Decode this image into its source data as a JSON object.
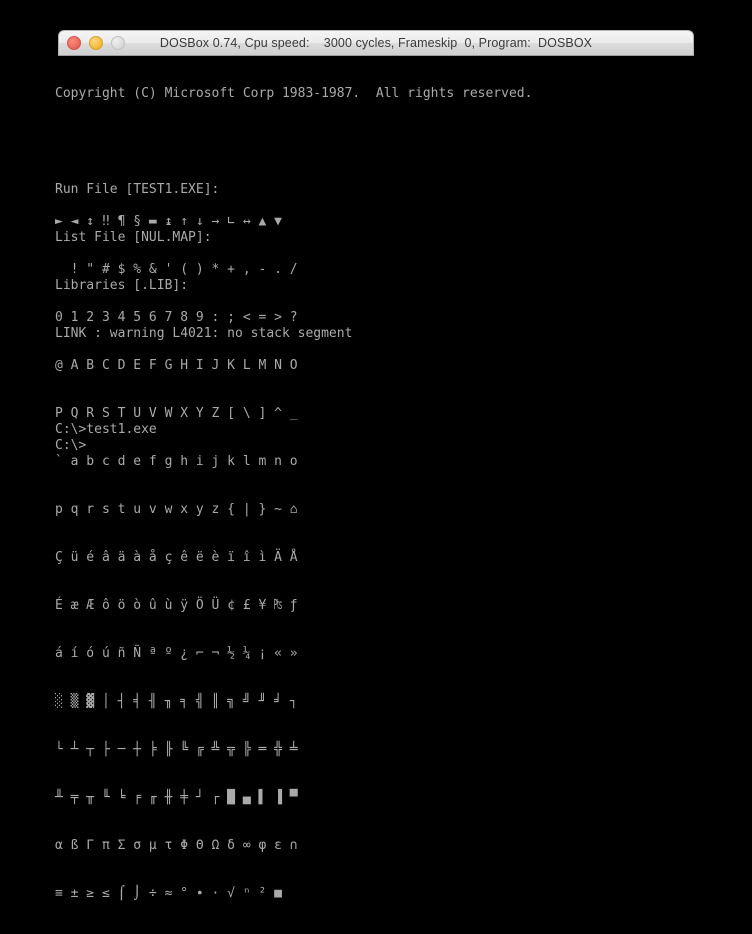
{
  "window": {
    "title": "DOSBox 0.74, Cpu speed:    3000 cycles, Frameskip  0, Program:  DOSBOX",
    "buttons": {
      "close": "close-button",
      "minimize": "minimize-button",
      "zoom": "zoom-button"
    },
    "colors": {
      "close": "#ee6a5f",
      "minimize": "#f6bd3b",
      "zoom": "#dcdcdc",
      "titlebar_bg": "#ececec",
      "title_text": "#3a3a3a"
    }
  },
  "console": {
    "colors": {
      "background": "#000000",
      "foreground": "#aaaaaa"
    },
    "lines": [
      "Copyright (C) Microsoft Corp 1983-1987.  All rights reserved.",
      "",
      "Run File [TEST1.EXE]:",
      "List File [NUL.MAP]:",
      "Libraries [.LIB]:",
      "LINK : warning L4021: no stack segment",
      "",
      "C:\\>test1.exe"
    ],
    "charmap_rows": [
      "► ◄ ↕ ‼ ¶ § ▬ ↨ ↑ ↓ → ∟ ↔ ▲ ▼",
      "  ! \" # $ % & ' ( ) * + , - . /",
      "0 1 2 3 4 5 6 7 8 9 : ; < = > ?",
      "@ A B C D E F G H I J K L M N O",
      "P Q R S T U V W X Y Z [ \\ ] ^ _",
      "` a b c d e f g h i j k l m n o",
      "p q r s t u v w x y z { | } ~ ⌂",
      "Ç ü é â ä à å ç ê ë è ï î ì Ä Å",
      "É æ Æ ô ö ò û ù ÿ Ö Ü ¢ £ ¥ ₧ ƒ",
      "á í ó ú ñ Ñ ª º ¿ ⌐ ¬ ½ ¼ ¡ « »",
      "░ ▒ ▓ │ ┤ ╡ ╢ ╖ ╕ ╣ ║ ╗ ╝ ╜ ╛ ┐",
      "└ ┴ ┬ ├ ─ ┼ ╞ ╟ ╚ ╔ ╩ ╦ ╠ ═ ╬ ╧",
      "╨ ╤ ╥ ╙ ╘ ╒ ╓ ╫ ╪ ┘ ┌ █ ▄ ▌ ▐ ▀",
      "α ß Γ π Σ σ µ τ Φ Θ Ω δ ∞ φ ε ∩",
      "≡ ± ≥ ≤ ⌠ ⌡ ÷ ≈ ° ∙ · √ ⁿ ² ■"
    ],
    "prompt": "C:\\>"
  }
}
